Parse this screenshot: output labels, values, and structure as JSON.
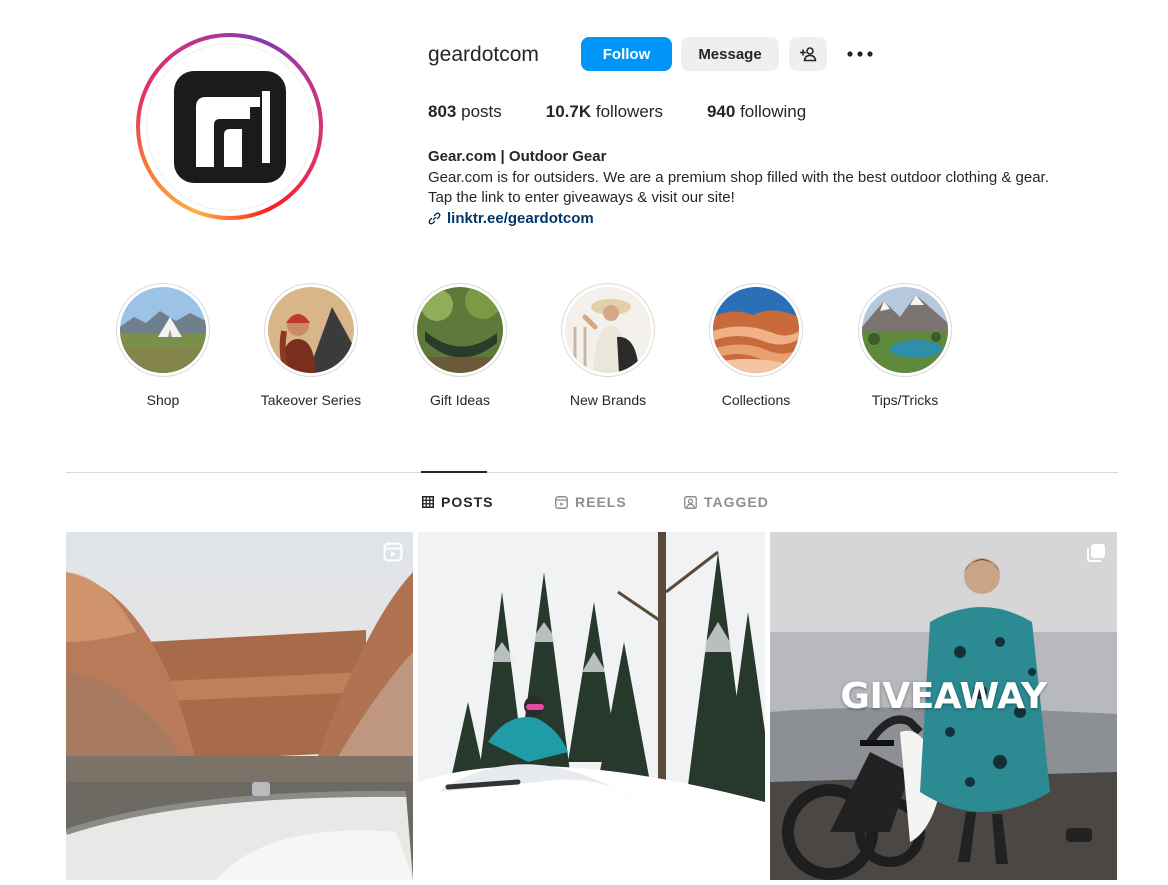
{
  "profile": {
    "username": "geardotcom",
    "follow_label": "Follow",
    "message_label": "Message",
    "stats": {
      "posts_count": "803",
      "posts_label": "posts",
      "followers_count": "10.7K",
      "followers_label": "followers",
      "following_count": "940",
      "following_label": "following"
    },
    "bio": {
      "name": "Gear.com | Outdoor Gear",
      "line1": "Gear.com is for outsiders. We are a premium shop filled with the best outdoor clothing & gear.",
      "line2": "Tap the link to enter giveaways & visit our site!",
      "link": "linktr.ee/geardotcom"
    }
  },
  "highlights": [
    {
      "label": "Shop"
    },
    {
      "label": "Takeover Series"
    },
    {
      "label": "Gift Ideas"
    },
    {
      "label": "New Brands"
    },
    {
      "label": "Collections"
    },
    {
      "label": "Tips/Tricks"
    }
  ],
  "tabs": [
    {
      "label": "POSTS",
      "active": true
    },
    {
      "label": "REELS",
      "active": false
    },
    {
      "label": "TAGGED",
      "active": false
    }
  ],
  "posts": [
    {
      "type": "reel",
      "badge_icon": "reel-icon"
    },
    {
      "type": "photo"
    },
    {
      "type": "carousel",
      "badge_icon": "carousel-icon",
      "overlay_text": "GIVEAWAY"
    }
  ],
  "colors": {
    "accent": "#0095f6",
    "link": "#00376b",
    "text": "#262626",
    "muted": "#8e8e8e",
    "button_secondary": "#efefef"
  }
}
